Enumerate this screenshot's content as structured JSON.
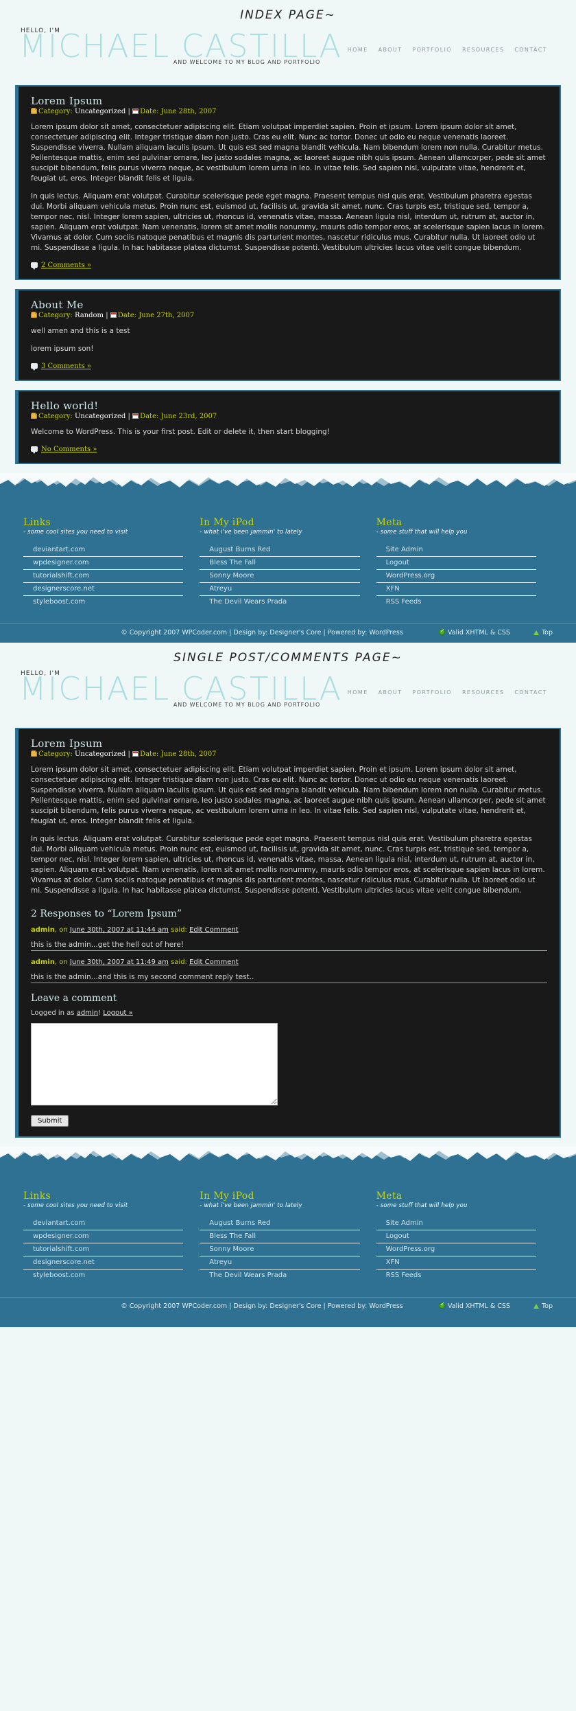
{
  "colors": {
    "page_bg": "#f0f7f7",
    "brand": "#aadde0",
    "post_bg": "#191919",
    "post_border": "#2e7192",
    "accent_yellow": "#c9d400",
    "footer_bg": "#2e7192",
    "heading_blue": "#cfe9ea"
  },
  "header": {
    "hello": "HELLO, I'M",
    "brand": "MICHAEL CASTILLA",
    "tagline": "AND WELCOME TO MY BLOG AND PORTFOLIO",
    "nav": [
      {
        "label": "HOME"
      },
      {
        "label": "ABOUT"
      },
      {
        "label": "PORTFOLIO"
      },
      {
        "label": "RESOURCES"
      },
      {
        "label": "CONTACT"
      }
    ]
  },
  "pages": {
    "index_label": "INDEX PAGE~",
    "single_label": "SINGLE POST/COMMENTS PAGE~"
  },
  "meta_labels": {
    "category": "Category:",
    "date": "Date:",
    "separator": "|"
  },
  "posts": [
    {
      "title": "Lorem Ipsum",
      "category": "Uncategorized",
      "date": "June 28th, 2007",
      "paragraphs": [
        "Lorem ipsum dolor sit amet, consectetuer adipiscing elit. Etiam volutpat imperdiet sapien. Proin et ipsum. Lorem ipsum dolor sit amet, consectetuer adipiscing elit. Integer tristique diam non justo. Cras eu elit. Nunc ac tortor. Donec ut odio eu neque venenatis laoreet. Suspendisse viverra. Nullam aliquam iaculis ipsum. Ut quis est sed magna blandit vehicula. Nam bibendum lorem non nulla. Curabitur metus. Pellentesque mattis, enim sed pulvinar ornare, leo justo sodales magna, ac laoreet augue nibh quis ipsum. Aenean ullamcorper, pede sit amet suscipit bibendum, felis purus viverra neque, ac vestibulum lorem urna in leo. In vitae felis. Sed sapien nisl, vulputate vitae, hendrerit et, feugiat ut, eros. Integer blandit felis et ligula.",
        "In quis lectus. Aliquam erat volutpat. Curabitur scelerisque pede eget magna. Praesent tempus nisl quis erat. Vestibulum pharetra egestas dui. Morbi aliquam vehicula metus. Proin nunc est, euismod ut, facilisis ut, gravida sit amet, nunc. Cras turpis est, tristique sed, tempor a, tempor nec, nisl. Integer lorem sapien, ultricies ut, rhoncus id, venenatis vitae, massa. Aenean ligula nisl, interdum ut, rutrum at, auctor in, sapien. Aliquam erat volutpat. Nam venenatis, lorem sit amet mollis nonummy, mauris odio tempor eros, at scelerisque sapien lacus in lorem. Vivamus at dolor. Cum sociis natoque penatibus et magnis dis parturient montes, nascetur ridiculus mus. Curabitur nulla. Ut laoreet odio ut mi. Suspendisse a ligula. In hac habitasse platea dictumst. Suspendisse potenti. Vestibulum ultricies lacus vitae velit congue bibendum."
      ],
      "comments_link": "2 Comments »"
    },
    {
      "title": "About Me",
      "category": "Random",
      "date": "June 27th, 2007",
      "paragraphs": [
        "well amen and this is a test",
        "lorem ipsum son!"
      ],
      "comments_link": "3 Comments »"
    },
    {
      "title": "Hello world!",
      "category": "Uncategorized",
      "date": "June 23rd, 2007",
      "paragraphs": [
        "Welcome to WordPress. This is your first post. Edit or delete it, then start blogging!"
      ],
      "comments_link": "No Comments »"
    }
  ],
  "single": {
    "responses_title": "2 Responses to “Lorem Ipsum”",
    "comments": [
      {
        "author": "admin",
        "on": ", on ",
        "date": "June 30th, 2007 at 11:44 am",
        "said": " said: ",
        "edit": "Edit Comment",
        "body": "this is the admin...get the hell out of here!"
      },
      {
        "author": "admin",
        "on": ", on ",
        "date": "June 30th, 2007 at 11:49 am",
        "said": " said: ",
        "edit": "Edit Comment",
        "body": "this is the admin...and this is my second comment reply test.."
      }
    ],
    "leave_title": "Leave a comment",
    "logged_in_prefix": "Logged in as ",
    "logged_in_user": "admin",
    "logged_in_suffix": "! ",
    "logout": "Logout »",
    "textarea_value": "",
    "submit_label": "Submit"
  },
  "footer": {
    "widgets": [
      {
        "title": "Links",
        "subtitle": "- some cool sites you need to visit",
        "items": [
          {
            "label": "deviantart.com"
          },
          {
            "label": "wpdesigner.com"
          },
          {
            "label": "tutorialshift.com"
          },
          {
            "label": "designerscore.net"
          },
          {
            "label": "styleboost.com"
          }
        ]
      },
      {
        "title": "In My iPod",
        "subtitle": "- what i've been jammin' to lately",
        "items": [
          {
            "label": "August Burns Red"
          },
          {
            "label": "Bless The Fall"
          },
          {
            "label": "Sonny Moore"
          },
          {
            "label": "Atreyu"
          },
          {
            "label": "The Devil Wears Prada"
          }
        ]
      },
      {
        "title": "Meta",
        "subtitle": "- some stuff that will help you",
        "items": [
          {
            "label": "Site Admin"
          },
          {
            "label": "Logout"
          },
          {
            "label": "WordPress.org"
          },
          {
            "label": "XFN"
          },
          {
            "label": "RSS Feeds"
          }
        ]
      }
    ],
    "copyright": "© Copyright 2007 WPCoder.com | Design by: Designer's Core | Powered by: WordPress",
    "valid": "Valid XHTML & CSS",
    "top": "Top"
  }
}
